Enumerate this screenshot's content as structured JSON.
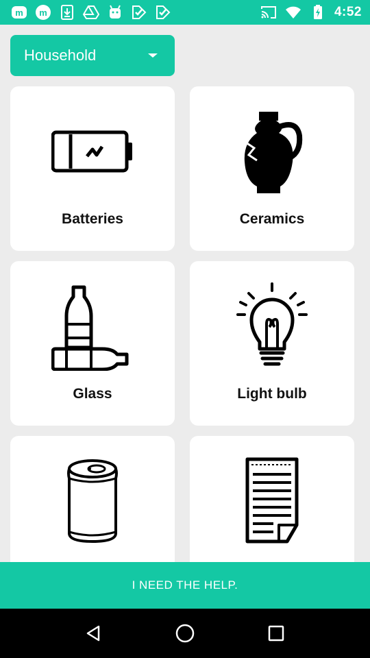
{
  "status_bar": {
    "time": "4:52",
    "left_icons": [
      "app-m-icon",
      "app-m-circle-icon",
      "download-icon",
      "drive-icon",
      "android-icon",
      "check-icon",
      "check-icon"
    ],
    "right_icons": [
      "cast-icon",
      "wifi-icon",
      "battery-charging-icon"
    ]
  },
  "category_select": {
    "selected": "Household"
  },
  "items": [
    {
      "label": "Batteries",
      "icon": "battery-icon"
    },
    {
      "label": "Ceramics",
      "icon": "vase-icon"
    },
    {
      "label": "Glass",
      "icon": "bottles-icon"
    },
    {
      "label": "Light bulb",
      "icon": "lightbulb-icon"
    },
    {
      "label": "",
      "icon": "can-icon"
    },
    {
      "label": "",
      "icon": "paper-icon"
    }
  ],
  "help_button": {
    "label": "I NEED THE HELP."
  },
  "nav": [
    "back-icon",
    "home-icon",
    "recents-icon"
  ],
  "colors": {
    "accent": "#14c8a4",
    "background": "#ececec",
    "card": "#ffffff"
  }
}
